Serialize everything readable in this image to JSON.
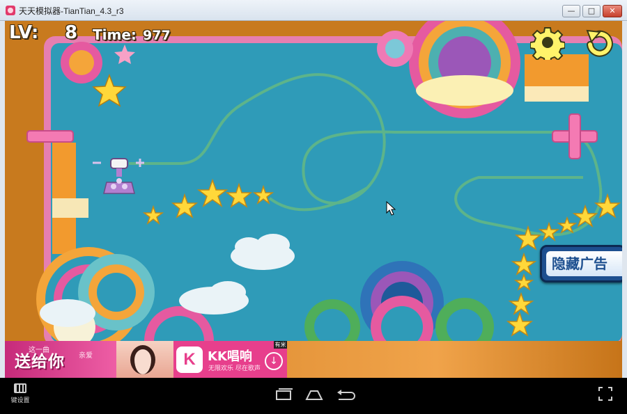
{
  "window": {
    "title": "天天模拟器-TianTian_4.3_r3",
    "min_glyph": "—",
    "max_glyph": "□",
    "close_glyph": "✕"
  },
  "game": {
    "level_label": "LV:",
    "level_value": "8",
    "time_label": "Time:",
    "time_value": "977",
    "hide_ad_label": "隐藏广告",
    "settings_icon": "gear-icon",
    "restart_icon": "restart-icon",
    "minus_icon": "minus-icon",
    "plus_icon": "plus-icon"
  },
  "ad": {
    "slogan_small": "这一曲",
    "slogan_side": "亲爱",
    "slogan": "送给你",
    "logo_text": "K",
    "brand": "KK唱响",
    "brand_sub": "无限欢乐 尽在歌声",
    "download_glyph": "↓",
    "tag": "有米"
  },
  "navbar": {
    "keymap_label": "键设置",
    "recent_icon": "recent-apps-icon",
    "home_icon": "home-icon",
    "back_icon": "back-icon",
    "fullscreen_icon": "fullscreen-icon"
  },
  "colors": {
    "frame": "#c87a1e",
    "board": "#2f9bb8",
    "track": "#5db48a",
    "star": "#ffd83a",
    "pink": "#e9679b",
    "ad": "#e73f8c"
  }
}
